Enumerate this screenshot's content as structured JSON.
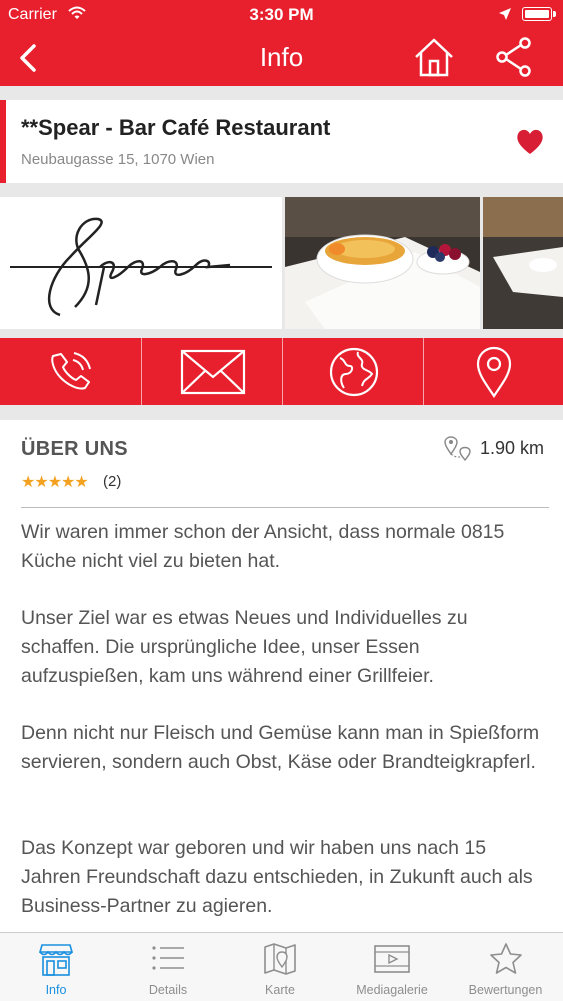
{
  "status_bar": {
    "carrier": "Carrier",
    "time": "3:30 PM"
  },
  "nav": {
    "title": "Info",
    "back_icon": "chevron-left-icon",
    "home_icon": "home-icon",
    "share_icon": "share-icon"
  },
  "venue": {
    "name": "**Spear - Bar Café Restaurant",
    "address": "Neubaugasse 15, 1070 Wien",
    "favorite": true
  },
  "gallery": {
    "logo_text": "Spear"
  },
  "actions": [
    {
      "name": "call-icon"
    },
    {
      "name": "mail-icon"
    },
    {
      "name": "web-icon"
    },
    {
      "name": "location-pin-icon"
    }
  ],
  "about": {
    "heading": "ÜBER UNS",
    "distance": "1.90 km",
    "stars": "★★★★★",
    "rating_count": "(2)",
    "paragraphs": [
      "Wir waren immer schon der Ansicht, dass normale 0815 Küche nicht viel zu bieten hat.",
      "Unser Ziel war es etwas Neues und Individuelles zu schaffen. Die ursprüngliche Idee, unser Essen aufzuspießen, kam uns während einer Grillfeier.",
      "Denn nicht nur Fleisch und Gemüse kann man in Spießform servieren, sondern auch Obst, Käse oder Brandteigkrapferl.",
      "Das Konzept war geboren und wir haben uns nach 15 Jahren Freundschaft dazu entschieden, in Zukunft auch als Business-Partner zu agieren."
    ]
  },
  "tabs": [
    {
      "label": "Info",
      "active": true
    },
    {
      "label": "Details",
      "active": false
    },
    {
      "label": "Karte",
      "active": false
    },
    {
      "label": "Mediagalerie",
      "active": false
    },
    {
      "label": "Bewertungen",
      "active": false
    }
  ],
  "colors": {
    "accent": "#e8202e",
    "active_tab": "#1a8fe0",
    "star": "#f3a11f"
  }
}
